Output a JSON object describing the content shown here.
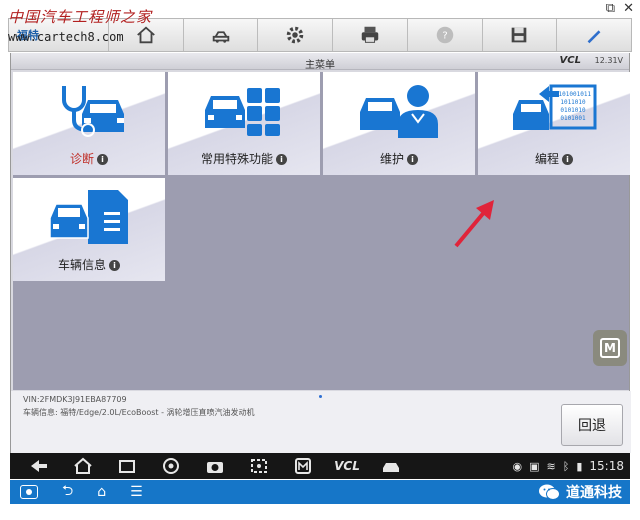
{
  "watermark": {
    "cn": "中国汽车工程师之家",
    "url": "www.cartech8.com"
  },
  "toolbar": {
    "brand": "福特",
    "icons": [
      "home-icon",
      "vehicle-swap-icon",
      "settings-icon",
      "print-icon",
      "help-icon",
      "save-icon",
      "edit-icon"
    ]
  },
  "window": {
    "controls": [
      "⧉",
      "✕"
    ]
  },
  "screen": {
    "title": "主菜单",
    "vcl": "VCL",
    "battery": "12.31V"
  },
  "tiles": [
    {
      "label": "诊断",
      "icon": "stethoscope-car-icon",
      "selected": false
    },
    {
      "label": "常用特殊功能",
      "icon": "car-grid-icon",
      "selected": false
    },
    {
      "label": "维护",
      "icon": "car-mechanic-icon",
      "selected": false
    },
    {
      "label": "编程",
      "icon": "car-binary-icon",
      "selected": true
    },
    {
      "label": "车辆信息",
      "icon": "car-document-icon",
      "selected": false
    }
  ],
  "info": {
    "vin": "VIN:2FMDK3J91EBA87709",
    "vehicle": "车辆信息: 福特/Edge/2.0L/EcoBoost - 涡轮增压直喷汽油发动机"
  },
  "buttons": {
    "back": "回退",
    "m": "M"
  },
  "nav": {
    "icons": [
      "back-arrow-icon",
      "home-icon",
      "recent-apps-icon",
      "browser-icon",
      "camera-icon",
      "screen-icon",
      "m-app-icon",
      "vcl-icon",
      "car-icon"
    ],
    "vcl_label": "VCL",
    "time": "15:18"
  },
  "footer": {
    "wechat_name": "道通科技"
  },
  "colors": {
    "tile_blue": "#1976d2",
    "selection": "#e0243a",
    "sysbar": "#1676c8",
    "arrow": "#e0243a"
  }
}
